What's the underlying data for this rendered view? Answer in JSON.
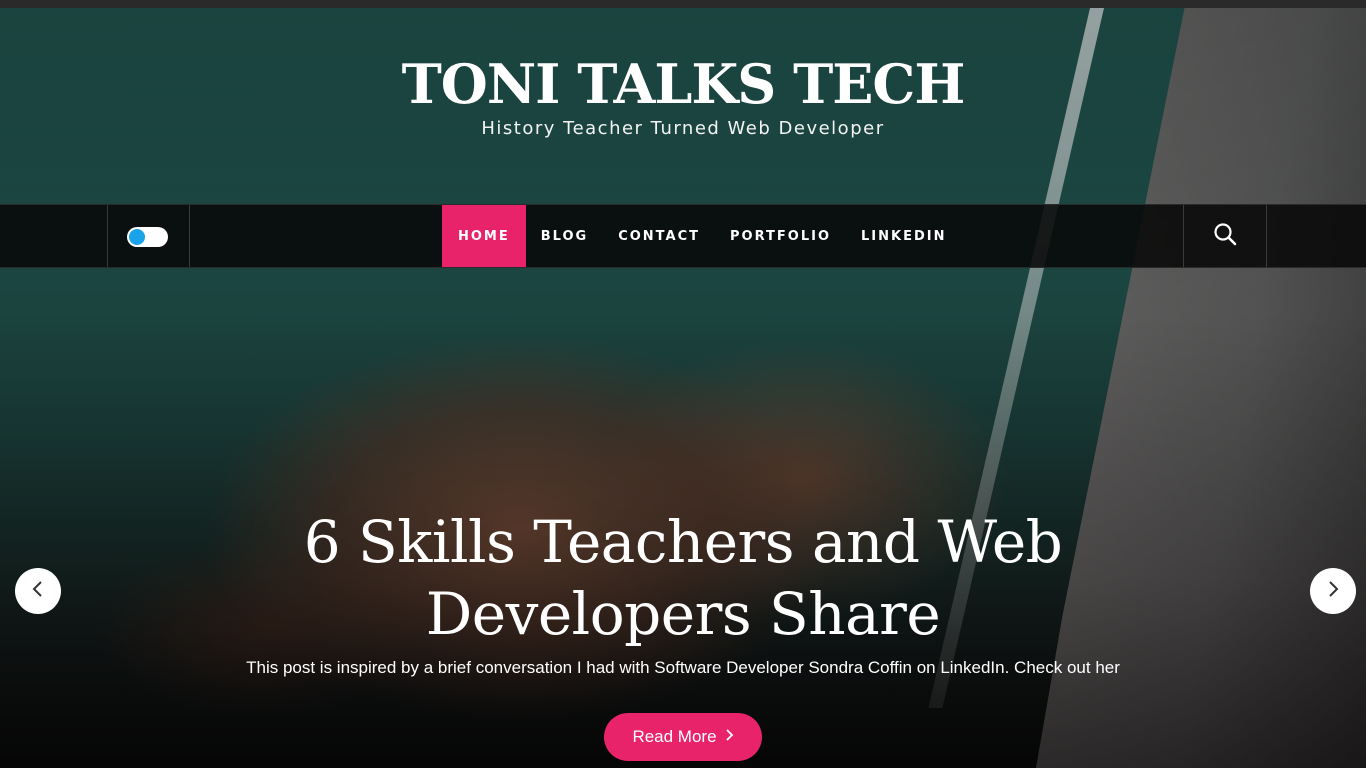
{
  "header": {
    "site_title": "TONI TALKS TECH",
    "tagline": "History Teacher Turned Web Developer"
  },
  "nav": {
    "items": [
      {
        "label": "HOME",
        "active": true
      },
      {
        "label": "BLOG",
        "active": false
      },
      {
        "label": "CONTACT",
        "active": false
      },
      {
        "label": "PORTFOLIO",
        "active": false
      },
      {
        "label": "LINKEDIN",
        "active": false
      }
    ],
    "theme_toggle_icon": "toggle-switch",
    "search_icon": "search-icon"
  },
  "slide": {
    "title": "6 Skills Teachers and Web Developers Share",
    "excerpt": "This post is inspired by a brief conversation I had with Software Developer Sondra Coffin on LinkedIn. Check out her",
    "button_label": "Read More",
    "prev_icon": "chevron-left-icon",
    "next_icon": "chevron-right-icon"
  },
  "colors": {
    "accent": "#e8236a",
    "toggle_knob": "#1aa3e8",
    "nav_bg": "#080808"
  }
}
